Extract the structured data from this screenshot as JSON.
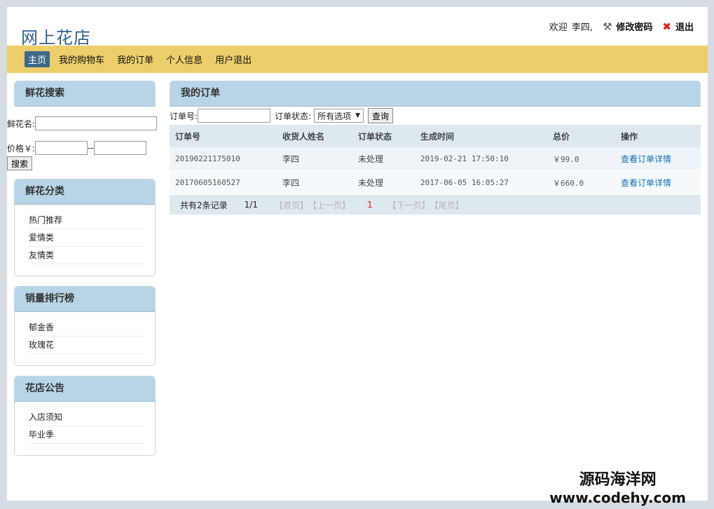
{
  "site": {
    "logo": "网上花店"
  },
  "userbar": {
    "welcome": "欢迎",
    "username": "李四,",
    "change_password": "修改密码",
    "logout": "退出"
  },
  "nav": {
    "items": [
      {
        "label": "主页",
        "active": true
      },
      {
        "label": "我的购物车",
        "active": false
      },
      {
        "label": "我的订单",
        "active": false
      },
      {
        "label": "个人信息",
        "active": false
      },
      {
        "label": "用户退出",
        "active": false
      }
    ]
  },
  "search": {
    "title": "鲜花搜索",
    "name_label": "鲜花名:",
    "name_value": "",
    "price_label": "价格￥:",
    "price_min": "",
    "price_sep": "--",
    "price_max": "",
    "button": "搜索"
  },
  "categories": {
    "title": "鲜花分类",
    "items": [
      "热门推荐",
      "爱情类",
      "友情类"
    ]
  },
  "ranking": {
    "title": "销量排行榜",
    "items": [
      "郁金香",
      "玫瑰花"
    ]
  },
  "notices": {
    "title": "花店公告",
    "items": [
      "入店须知",
      "毕业季"
    ]
  },
  "orders": {
    "title": "我的订单",
    "filter": {
      "order_no_label": "订单号:",
      "order_no_value": "",
      "status_label": "订单状态:",
      "status_selected": "所有选项",
      "query_button": "查询"
    },
    "columns": [
      "订单号",
      "收货人姓名",
      "订单状态",
      "生成时间",
      "总价",
      "操作"
    ],
    "rows": [
      {
        "order_no": "20190221175010",
        "receiver": "李四",
        "status": "未处理",
        "created": "2019-02-21 17:50:10",
        "total": "￥99.0",
        "action": "查看订单详情"
      },
      {
        "order_no": "20170605160527",
        "receiver": "李四",
        "status": "未处理",
        "created": "2017-06-05 16:05:27",
        "total": "￥660.0",
        "action": "查看订单详情"
      }
    ],
    "pager": {
      "total": "共有2条记录",
      "page": "1/1",
      "first": "【首页】",
      "prev": "【上一页】",
      "current": "1",
      "next": "【下一页】",
      "last": "【尾页】"
    }
  },
  "watermark": {
    "line1": "源码海洋网",
    "line2": "www.codehy.com"
  }
}
